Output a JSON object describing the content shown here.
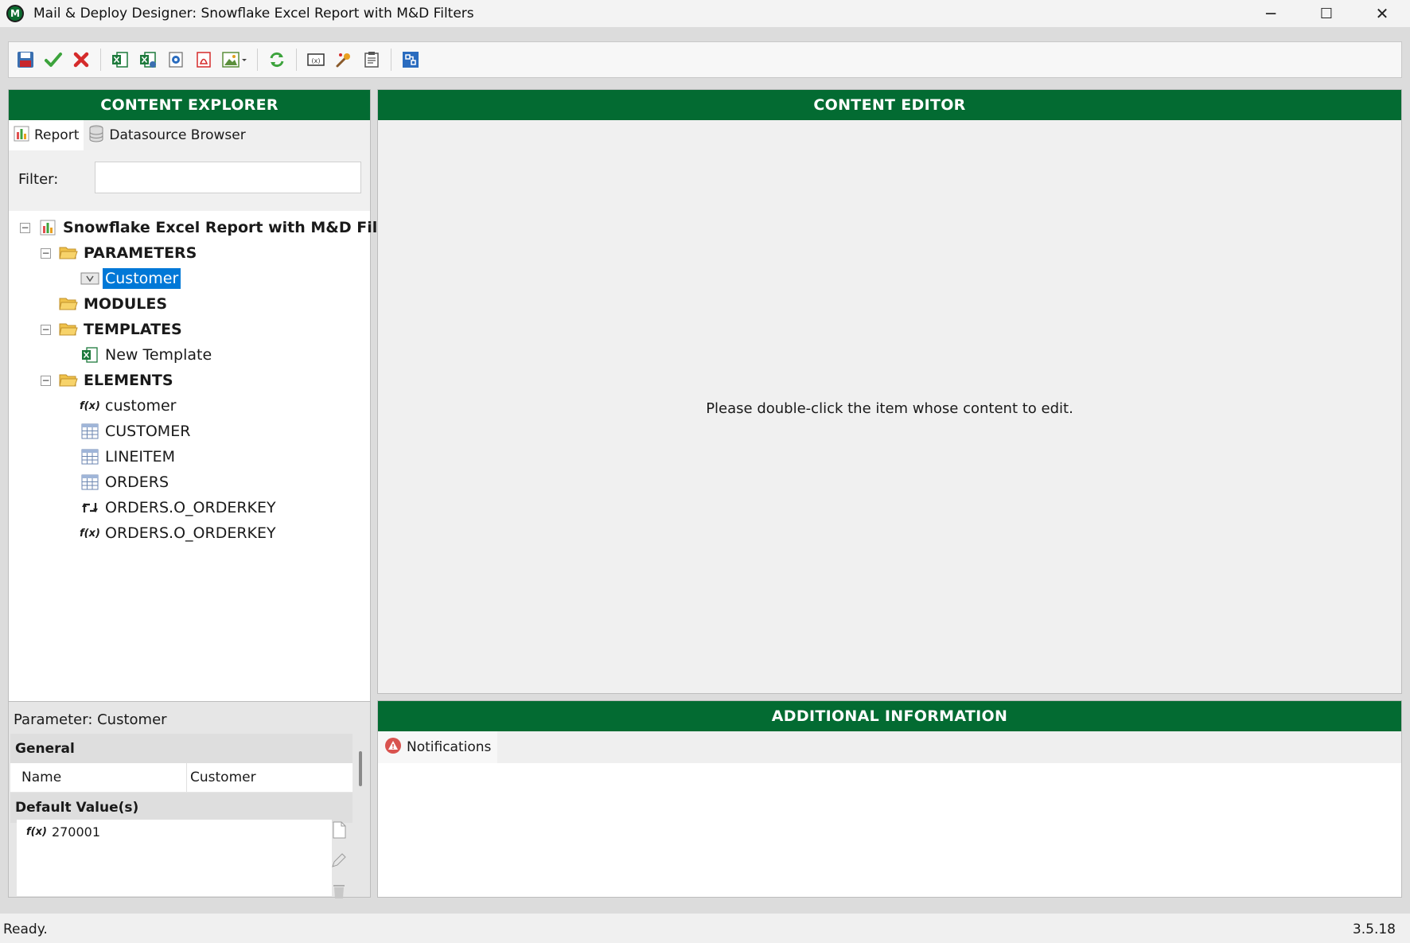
{
  "window": {
    "title": "Mail & Deploy Designer: Snowflake Excel Report with M&D Filters",
    "logo_letter": "M",
    "minimize": "─",
    "maximize": "☐",
    "close": "✕"
  },
  "toolbar": {
    "icons": [
      "save-icon",
      "apply-icon",
      "discard-icon",
      "excel-icon",
      "excel-export-icon",
      "outlook-icon",
      "pdf-icon",
      "image-icon",
      "refresh-icon",
      "variable-icon",
      "wizard-icon",
      "clipboard-icon",
      "structure-icon"
    ]
  },
  "explorer": {
    "header": "CONTENT EXPLORER",
    "tabs": [
      {
        "label": "Report",
        "icon": "report-chart-icon"
      },
      {
        "label": "Datasource Browser",
        "icon": "database-icon"
      }
    ],
    "filter_label": "Filter:",
    "filter_value": "",
    "tree": {
      "root": "Snowflake Excel Report with M&D Filters",
      "parameters": "PARAMETERS",
      "customer_param": "Customer",
      "modules": "MODULES",
      "templates": "TEMPLATES",
      "new_template": "New Template",
      "elements": "ELEMENTS",
      "el_customer_fn": "customer",
      "el_customer_table": "CUSTOMER",
      "el_lineitem": "LINEITEM",
      "el_orders": "ORDERS",
      "el_orderkey_rel": "ORDERS.O_ORDERKEY",
      "el_orderkey_fn": "ORDERS.O_ORDERKEY"
    }
  },
  "properties": {
    "title": "Parameter: Customer",
    "general_label": "General",
    "name_key": "Name",
    "name_value": "Customer",
    "defaults_label": "Default Value(s)",
    "default_fx": "f(x)",
    "default_value": "270001"
  },
  "editor": {
    "header": "CONTENT EDITOR",
    "message": "Please double-click the item whose content to edit."
  },
  "additional": {
    "header": "ADDITIONAL INFORMATION",
    "notifications_tab": "Notifications"
  },
  "status": {
    "text": "Ready.",
    "version": "3.5.18"
  },
  "colors": {
    "header_green": "#036b32",
    "selection_blue": "#0078d7"
  }
}
